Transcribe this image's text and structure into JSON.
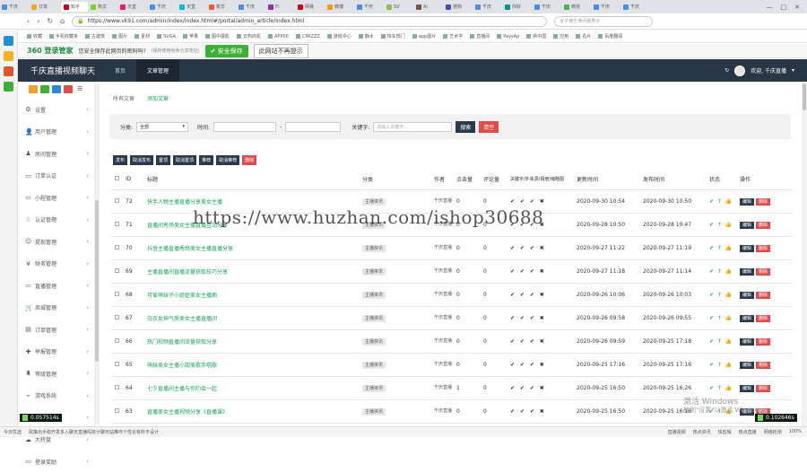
{
  "browser": {
    "tabs": [
      "千庆",
      "订单",
      "知乎",
      "热文",
      "天堂",
      "千庆",
      "天堂",
      "新华",
      "千庆",
      "Fi",
      "网易",
      "微博",
      "千庆",
      "SV",
      "Ai",
      "搜狗",
      "千庆",
      "你好",
      "千庆",
      "微信",
      "千庆",
      "千庆"
    ],
    "active_tab": "千庆",
    "url": "https://www.vk91.com/admin/index/index.html#/portal/admin_article/index.html",
    "search_placeholder": "女子被生命问题男子",
    "bookmarks": [
      "收藏",
      "手机收藏夹",
      "古建筑",
      "图片",
      "素材",
      "SVGA",
      "苹果",
      "图中展影",
      "云构商机",
      "APP00",
      "CPAZZZ",
      "游戏中心",
      "静水",
      "快车部门",
      "app图片",
      "艺术字",
      "直播间",
      "PaysAp",
      "新中国",
      "应用",
      "名片",
      "百度翻译"
    ]
  },
  "infobar": {
    "logo": "360 登录管家",
    "message": "您安全保存此网页的密码吗?",
    "hint": "(保存使用哈希分享地址)",
    "save_label": "安全保存",
    "dismiss_label": "此网站不再提示"
  },
  "app": {
    "title": "千庆直播视频聊天",
    "nav": [
      "首页",
      "文章管理"
    ],
    "user": "欢迎, 千庆直播"
  },
  "sidebar": {
    "items": [
      {
        "icon": "⚙",
        "label": "设置"
      },
      {
        "icon": "👤",
        "label": "用户管理"
      },
      {
        "icon": "♟",
        "label": "房间管理"
      },
      {
        "icon": "▭",
        "label": "订单认证"
      },
      {
        "icon": "▭",
        "label": "小程管理"
      },
      {
        "icon": "☆",
        "label": "认证管理"
      },
      {
        "icon": "☺",
        "label": "提现管理"
      },
      {
        "icon": "¥",
        "label": "财务管理"
      },
      {
        "icon": "▭",
        "label": "直播管理"
      },
      {
        "icon": "🛒",
        "label": "商城管理"
      },
      {
        "icon": "▤",
        "label": "订单管理"
      },
      {
        "icon": "✚",
        "label": "举报管理"
      },
      {
        "icon": "♜",
        "label": "等级管理"
      },
      {
        "icon": "⌁",
        "label": "游戏系统"
      },
      {
        "icon": "▤",
        "label": "店铺管理"
      },
      {
        "icon": "☁",
        "label": "大转盘"
      },
      {
        "icon": "▭",
        "label": "登录奖励"
      }
    ]
  },
  "subtabs": {
    "list": "所有文章",
    "add": "添加文章"
  },
  "filter": {
    "category_label": "分类:",
    "category_value": "全部",
    "time_label": "时间:",
    "keyword_label": "关键字:",
    "keyword_placeholder": "请输入关键字...",
    "search_label": "搜索",
    "clear_label": "清空"
  },
  "actions": [
    "发布",
    "取消发布",
    "置顶",
    "取消置顶",
    "推荐",
    "取消推荐",
    "删除"
  ],
  "table": {
    "headers": [
      "ID",
      "标题",
      "分类",
      "作者",
      "点击量",
      "评论量",
      "关键字/外来源/相册/缩略图",
      "更新时间",
      "发布时间",
      "状态",
      "操作"
    ],
    "rows": [
      {
        "id": "72",
        "title": "快手人物主播直播分享美女主播",
        "category": "主播资讯",
        "author": "千庆直播",
        "clicks": "0",
        "comments": "0",
        "flags": "✔ ✔ ✔ ✖",
        "updated": "2020-09-30 10:54",
        "published": "2020-09-30 10:50"
      },
      {
        "id": "71",
        "title": "直播间秀场美女主播直播互动分享",
        "category": "主播资讯",
        "author": "千庆直播",
        "clicks": "0",
        "comments": "0",
        "flags": "✔ ✔ ✔ ✖",
        "updated": "2020-09-28 10:50",
        "published": "2020-09-28 10:47"
      },
      {
        "id": "70",
        "title": "抖音主播直播秀场美女主播直播分享",
        "category": "主播资讯",
        "author": "千庆直播",
        "clicks": "0",
        "comments": "0",
        "flags": "✔ ✔ ✔ ✖",
        "updated": "2020-09-27 11:22",
        "published": "2020-09-27 11:19"
      },
      {
        "id": "69",
        "title": "主播直播间直播流量获取技巧分享",
        "category": "主播资讯",
        "author": "千庆直播",
        "clicks": "0",
        "comments": "0",
        "flags": "✔ ✔ ✔ ✖",
        "updated": "2020-09-27 11:18",
        "published": "2020-09-27 11:14"
      },
      {
        "id": "68",
        "title": "可爱萌妹子小姐姐美女主播图",
        "category": "主播资讯",
        "author": "千庆直播",
        "clicks": "0",
        "comments": "0",
        "flags": "✔ ✔ ✔ ✖",
        "updated": "2020-09-26 10:06",
        "published": "2020-09-26 10:03"
      },
      {
        "id": "67",
        "title": "白衣女神气质美女主播直播间",
        "category": "主播资讯",
        "author": "千庆直播",
        "clicks": "0",
        "comments": "0",
        "flags": "✔ ✔ ✔ ✖",
        "updated": "2020-09-26 09:58",
        "published": "2020-09-26 09:55"
      },
      {
        "id": "66",
        "title": "热门视频直播间流量获取分享",
        "category": "主播资讯",
        "author": "千庆直播",
        "clicks": "0",
        "comments": "0",
        "flags": "✔ ✔ ✔ ✖",
        "updated": "2020-09-26 09:59",
        "published": "2020-09-25 17:18"
      },
      {
        "id": "65",
        "title": "萌妹美女主播小甜美歌手唱歌",
        "category": "主播资讯",
        "author": "千庆直播",
        "clicks": "0",
        "comments": "0",
        "flags": "✔ ✔ ✔ ✖",
        "updated": "2020-09-25 17:16",
        "published": "2020-09-25 17:16"
      },
      {
        "id": "64",
        "title": "七夕直播间主播与你约会一起",
        "category": "主播资讯",
        "author": "千庆直播",
        "clicks": "1",
        "comments": "0",
        "flags": "✔ ✔ ✔ ✖",
        "updated": "2020-09-25 16:50",
        "published": "2020-09-25 16:26"
      },
      {
        "id": "63",
        "title": "直播美女主播视频分享《直播课》",
        "category": "主播资讯",
        "author": "千庆直播",
        "clicks": "0",
        "comments": "0",
        "flags": "✔ ✔ ✔ ✖",
        "updated": "2020-09-25 16:50",
        "published": "2020-09-25 16:18"
      }
    ],
    "status_icons": "✔ ↑ 👍",
    "edit_label": "编辑",
    "delete_label": "删除"
  },
  "overlay": {
    "watermark": "https://www.huzhan.com/ishop30688",
    "activation_line1": "激活 Windows",
    "activation_line2": "转到\"设置\"以激活 Windows。"
  },
  "perf": {
    "left": "0.057514s",
    "right": "0.102646s"
  },
  "statusbar": {
    "left": "今日优选",
    "news": "政策出手稳开发多入聊天直播吗技计聊天站推环个性论有所不设计",
    "right": [
      "直播视频",
      "热点资讯",
      "快剪辑",
      "热点直播",
      "网络检测"
    ],
    "zoom": "100%"
  },
  "colors": {
    "header": "#283645",
    "link": "#18a058",
    "danger": "#e04b4b",
    "dark_btn": "#2a3a4c",
    "save_green": "#3cb034"
  }
}
